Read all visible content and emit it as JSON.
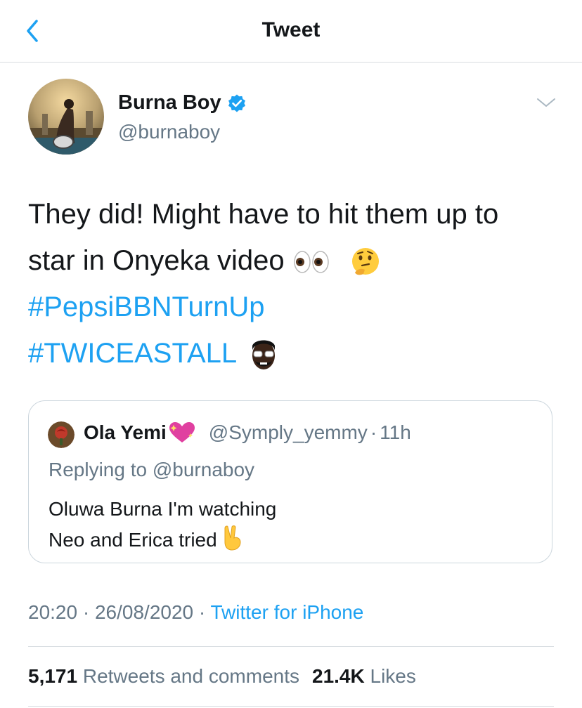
{
  "header": {
    "title": "Tweet",
    "back_icon": "chevron-left-icon"
  },
  "author": {
    "name": "Burna Boy",
    "handle": "@burnaboy",
    "verified": true
  },
  "tweet": {
    "line1": "They did! Might have to hit them up to",
    "line2": "star in Onyeka video",
    "line2_emojis": [
      "eyes-emoji",
      "thinking-face-emoji"
    ],
    "hashtag1": "#PepsiBBNTurnUp",
    "hashtag2": "#TWICEASTALL",
    "hashtag2_emoji": "burna-boy-emoji"
  },
  "quote": {
    "name": "Ola Yemi",
    "name_emoji": "sparkling-heart-emoji",
    "handle": "@Symply_yemmy",
    "separator": "·",
    "time": "11h",
    "replying_to": "Replying to @burnaboy",
    "text_line1": "Oluwa Burna I'm watching",
    "text_line2": "Neo and Erica tried",
    "text_emoji": "victory-hand-emoji"
  },
  "meta": {
    "time": "20:20",
    "sep1": "·",
    "date": "26/08/2020",
    "sep2": "·",
    "source": "Twitter for iPhone"
  },
  "stats": {
    "retweets_count": "5,171",
    "retweets_label": "Retweets and comments",
    "likes_count": "21.4K",
    "likes_label": "Likes"
  },
  "colors": {
    "accent": "#1da1f2",
    "text": "#14171a",
    "muted": "#657786",
    "border": "#ccd6dd"
  }
}
